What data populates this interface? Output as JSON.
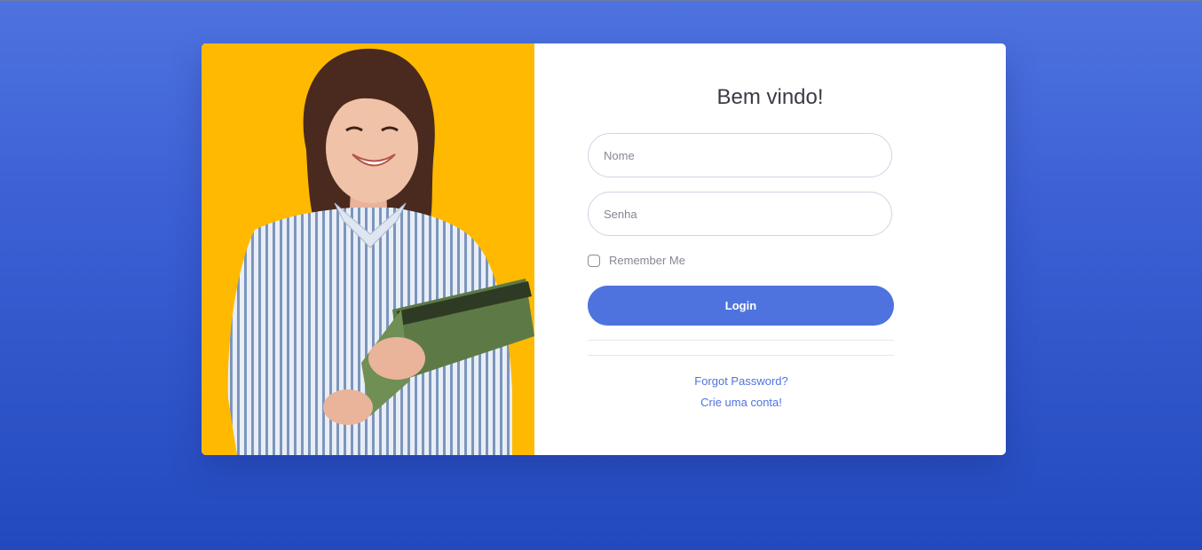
{
  "page": {
    "accent_color": "#4e73df",
    "photo_background_color": "#ffb900"
  },
  "login": {
    "title": "Bem vindo!",
    "name_placeholder": "Nome",
    "password_placeholder": "Senha",
    "remember_label": "Remember Me",
    "login_label": "Login",
    "forgot_link": "Forgot Password?",
    "create_link": "Crie uma conta!"
  },
  "photo": {
    "icon": "person-holding-folder-photo"
  }
}
